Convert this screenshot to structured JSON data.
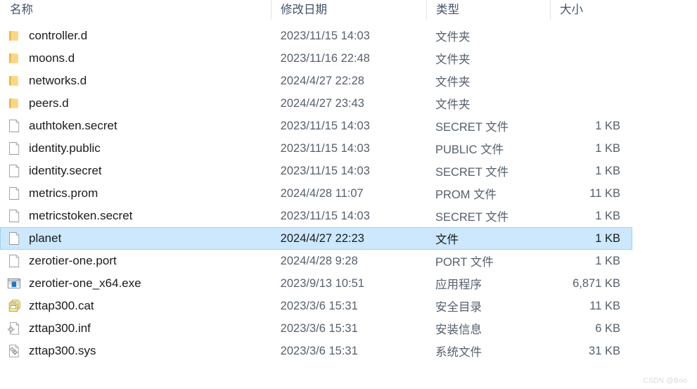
{
  "columns": {
    "name": "名称",
    "date_modified": "修改日期",
    "type": "类型",
    "size": "大小"
  },
  "colors": {
    "selection_background": "#cce8ff",
    "selection_border": "#99d1ff",
    "header_text": "#41546d",
    "row_text": "#1b1b1b",
    "secondary_text": "#55606e",
    "folder_icon": "#fcd77f",
    "exe_icon_accent": "#1277d4",
    "cat_icon": "#f2e9a0"
  },
  "watermark": "CSDN @Boo",
  "files": [
    {
      "name": "controller.d",
      "date": "2023/11/15 14:03",
      "type": "文件夹",
      "size": "",
      "icon": "folder-icon",
      "selected": false
    },
    {
      "name": "moons.d",
      "date": "2023/11/16 22:48",
      "type": "文件夹",
      "size": "",
      "icon": "folder-icon",
      "selected": false
    },
    {
      "name": "networks.d",
      "date": "2024/4/27 22:28",
      "type": "文件夹",
      "size": "",
      "icon": "folder-icon",
      "selected": false
    },
    {
      "name": "peers.d",
      "date": "2024/4/27 23:43",
      "type": "文件夹",
      "size": "",
      "icon": "folder-icon",
      "selected": false
    },
    {
      "name": "authtoken.secret",
      "date": "2023/11/15 14:03",
      "type": "SECRET 文件",
      "size": "1 KB",
      "icon": "blank-file-icon",
      "selected": false
    },
    {
      "name": "identity.public",
      "date": "2023/11/15 14:03",
      "type": "PUBLIC 文件",
      "size": "1 KB",
      "icon": "blank-file-icon",
      "selected": false
    },
    {
      "name": "identity.secret",
      "date": "2023/11/15 14:03",
      "type": "SECRET 文件",
      "size": "1 KB",
      "icon": "blank-file-icon",
      "selected": false
    },
    {
      "name": "metrics.prom",
      "date": "2024/4/28 11:07",
      "type": "PROM 文件",
      "size": "11 KB",
      "icon": "blank-file-icon",
      "selected": false
    },
    {
      "name": "metricstoken.secret",
      "date": "2023/11/15 14:03",
      "type": "SECRET 文件",
      "size": "1 KB",
      "icon": "blank-file-icon",
      "selected": false
    },
    {
      "name": "planet",
      "date": "2024/4/27 22:23",
      "type": "文件",
      "size": "1 KB",
      "icon": "blank-file-icon",
      "selected": true
    },
    {
      "name": "zerotier-one.port",
      "date": "2024/4/28 9:28",
      "type": "PORT 文件",
      "size": "1 KB",
      "icon": "blank-file-icon",
      "selected": false
    },
    {
      "name": "zerotier-one_x64.exe",
      "date": "2023/9/13 10:51",
      "type": "应用程序",
      "size": "6,871 KB",
      "icon": "application-icon",
      "selected": false
    },
    {
      "name": "zttap300.cat",
      "date": "2023/3/6 15:31",
      "type": "安全目录",
      "size": "11 KB",
      "icon": "security-catalog-icon",
      "selected": false
    },
    {
      "name": "zttap300.inf",
      "date": "2023/3/6 15:31",
      "type": "安装信息",
      "size": "6 KB",
      "icon": "setup-information-icon",
      "selected": false
    },
    {
      "name": "zttap300.sys",
      "date": "2023/3/6 15:31",
      "type": "系统文件",
      "size": "31 KB",
      "icon": "system-file-icon",
      "selected": false
    }
  ]
}
